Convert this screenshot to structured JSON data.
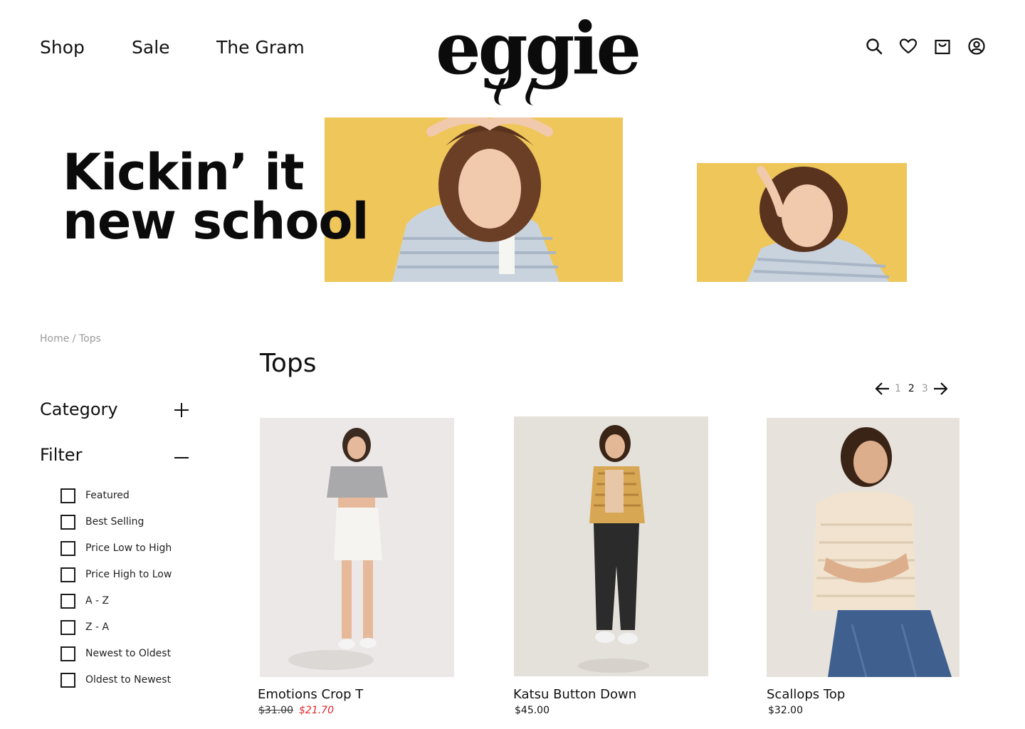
{
  "nav": {
    "shop": "Shop",
    "sale": "Sale",
    "gram": "The Gram"
  },
  "brand": {
    "logo_text": "eggie"
  },
  "header_icons": [
    "search-icon",
    "heart-icon",
    "bag-icon",
    "account-icon"
  ],
  "hero": {
    "line1": "Kickin’ it",
    "line2": "new school",
    "bg_color": "#efc659"
  },
  "breadcrumb": {
    "home": "Home",
    "separator": " / ",
    "current": "Tops"
  },
  "sidebar": {
    "category_label": "Category",
    "filter_label": "Filter",
    "filters": [
      {
        "label": "Featured",
        "checked": false
      },
      {
        "label": "Best Selling",
        "checked": false
      },
      {
        "label": "Price Low to High",
        "checked": false
      },
      {
        "label": "Price High to Low",
        "checked": false
      },
      {
        "label": "A - Z",
        "checked": false
      },
      {
        "label": "Z - A",
        "checked": false
      },
      {
        "label": "Newest to Oldest",
        "checked": false
      },
      {
        "label": "Oldest to Newest",
        "checked": false
      }
    ]
  },
  "main": {
    "title": "Tops",
    "pagination": {
      "pages": [
        "1",
        "2",
        "3"
      ],
      "current": "2"
    }
  },
  "products": [
    {
      "name": "Emotions Crop T",
      "price": "$31.00",
      "sale_price": "$21.70"
    },
    {
      "name": "Katsu Button Down",
      "price": "$45.00"
    },
    {
      "name": "Scallops Top",
      "price": "$32.00"
    }
  ],
  "colors": {
    "sale": "#e0262b",
    "muted": "#9a9a9a",
    "text": "#111111"
  }
}
